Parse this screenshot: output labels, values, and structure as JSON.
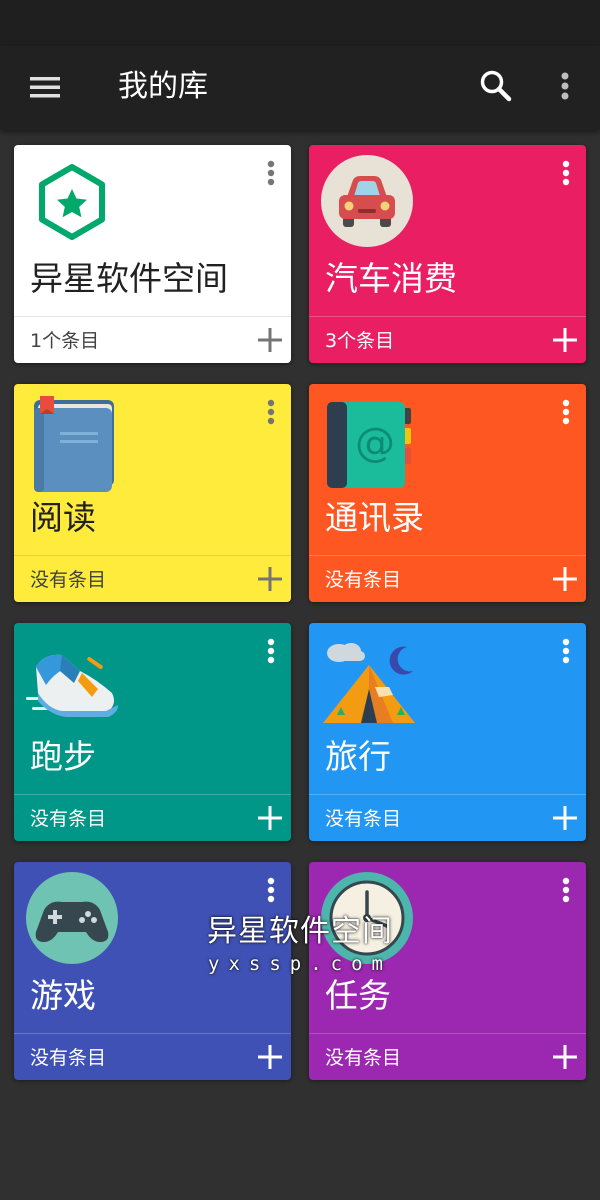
{
  "app": {
    "title": "我的库",
    "bar_color": "#212121",
    "background_color": "#303030",
    "icons": {
      "menu": "hamburger-menu-icon",
      "search": "search-icon",
      "more": "more-vert-icon"
    }
  },
  "cards": [
    {
      "name": "异星软件空间",
      "count": "1个条目",
      "color": "#ffffff",
      "icon": "star-hexagon-icon",
      "theme": "light"
    },
    {
      "name": "汽车消费",
      "count": "3个条目",
      "color": "#e91e63",
      "icon": "car-icon",
      "theme": "dark"
    },
    {
      "name": "阅读",
      "count": "没有条目",
      "color": "#ffeb3b",
      "icon": "book-icon",
      "theme": "light"
    },
    {
      "name": "通讯录",
      "count": "没有条目",
      "color": "#ff5722",
      "icon": "address-book-icon",
      "theme": "dark"
    },
    {
      "name": "跑步",
      "count": "没有条目",
      "color": "#009688",
      "icon": "running-shoe-icon",
      "theme": "dark"
    },
    {
      "name": "旅行",
      "count": "没有条目",
      "color": "#2196f3",
      "icon": "tent-icon",
      "theme": "dark"
    },
    {
      "name": "游戏",
      "count": "没有条目",
      "color": "#3f51b5",
      "icon": "gamepad-icon",
      "theme": "dark"
    },
    {
      "name": "任务",
      "count": "没有条目",
      "color": "#9c27b0",
      "icon": "clock-icon",
      "theme": "dark"
    }
  ],
  "watermark": {
    "title": "异星软件空间",
    "url": "yxssp.com"
  }
}
